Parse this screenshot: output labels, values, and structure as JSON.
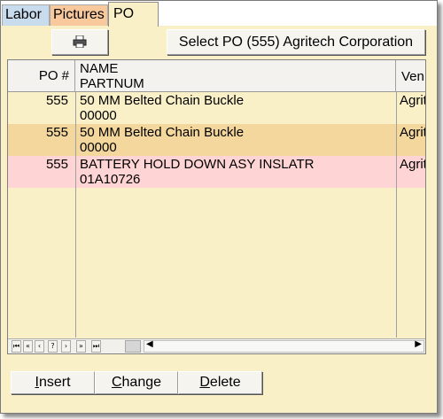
{
  "tabs": [
    {
      "label": "Labor",
      "color": "#c9dcee"
    },
    {
      "label": "Pictures",
      "color": "#f7c99c"
    },
    {
      "label": "PO",
      "color": "#faf0c8",
      "active": true
    }
  ],
  "toolbar": {
    "print_icon": "printer-icon",
    "select_label": "Select PO (555) Agritech Corporation"
  },
  "grid": {
    "columns": {
      "po": "PO #",
      "name": "NAME",
      "partnum": "PARTNUM",
      "vendor": "Ven"
    },
    "rows": [
      {
        "po": "555",
        "name": "50 MM Belted Chain Buckle",
        "partnum": "00000",
        "vendor": "Agrit",
        "bg": "#faf0c8"
      },
      {
        "po": "555",
        "name": "50 MM Belted Chain Buckle",
        "partnum": "00000",
        "vendor": "Agrit",
        "bg": "#f3d79c"
      },
      {
        "po": "555",
        "name": "BATTERY HOLD DOWN ASY INSLATR",
        "partnum": "01A10726",
        "vendor": "Agrit",
        "bg": "#ffd4d4"
      }
    ],
    "nav_buttons": [
      "⏮",
      "«",
      "‹",
      "?",
      "›",
      "»",
      "⏭"
    ]
  },
  "actions": {
    "insert_first": "I",
    "insert_rest": "nsert",
    "change_first": "C",
    "change_rest": "hange",
    "delete_first": "D",
    "delete_rest": "elete"
  }
}
